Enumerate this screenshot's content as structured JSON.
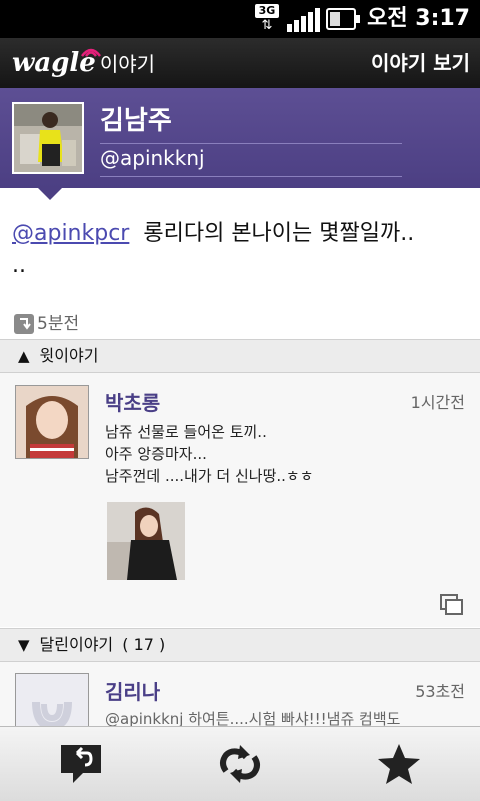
{
  "status_bar": {
    "network": "3G",
    "time": "오전 3:17",
    "signal_bars": 4,
    "battery_level": 0.45
  },
  "title_bar": {
    "logo_text": "wagle",
    "logo_sub": "이야기",
    "action": "이야기 보기"
  },
  "profile": {
    "name": "김남주",
    "handle": "@apinkknj"
  },
  "message": {
    "mention": "@apinkpcr",
    "text": "롱리다의 본나이는 몇짤일까..\n..",
    "time": "5분전"
  },
  "upper_section": {
    "label": "윗이야기"
  },
  "upper_post": {
    "name": "박초롱",
    "time": "1시간전",
    "text": "남쥬 선물로 들어온 토끼..\n아주 앙증마자...\n남주껀데 ....내가 더 신나땅..ㅎㅎ"
  },
  "replies_section": {
    "label": "달린이야기",
    "count_text": "( 17 )"
  },
  "reply_post": {
    "name": "김리나",
    "time": "53초전",
    "text": "@apinkknj 하여튼....시험 빠샤!!!냄쥬 컴백도"
  },
  "toolbar": {
    "icons": [
      "reply-icon",
      "repost-icon",
      "star-icon"
    ]
  }
}
